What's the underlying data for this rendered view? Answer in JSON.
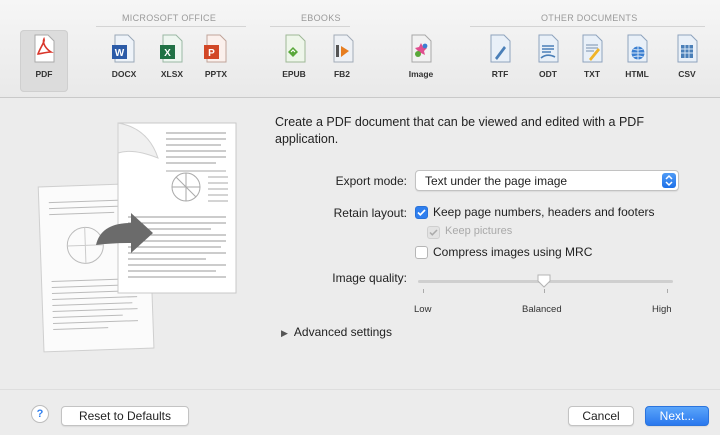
{
  "toolbar": {
    "groups": {
      "office": "MICROSOFT OFFICE",
      "ebooks": "EBOOKS",
      "other": "OTHER DOCUMENTS"
    },
    "formats": {
      "pdf": "PDF",
      "docx": "DOCX",
      "xlsx": "XLSX",
      "pptx": "PPTX",
      "epub": "EPUB",
      "fb2": "FB2",
      "image": "Image",
      "rtf": "RTF",
      "odt": "ODT",
      "txt": "TXT",
      "html": "HTML",
      "csv": "CSV"
    },
    "selected": "PDF",
    "colors": {
      "pdf": "#d9362b",
      "word": "#2b5ba8",
      "excel": "#207245",
      "ppt": "#d24726",
      "epub": "#59a83a",
      "fb2": "#e67e22",
      "doc": "#4a7fb8"
    }
  },
  "main": {
    "description": "Create a PDF document that can be viewed and edited with a PDF application.",
    "export_mode": {
      "label": "Export mode:",
      "value": "Text under the page image"
    },
    "retain_layout": {
      "label": "Retain layout:"
    },
    "options": {
      "page_numbers": {
        "label": "Keep page numbers, headers and footers",
        "checked": true
      },
      "pictures": {
        "label": "Keep pictures",
        "checked": true,
        "disabled": true
      },
      "mrc": {
        "label": "Compress images using MRC",
        "checked": false
      }
    },
    "image_quality": {
      "label": "Image quality:",
      "ticks": {
        "low": "Low",
        "balanced": "Balanced",
        "high": "High"
      },
      "value": "Balanced"
    },
    "advanced": "Advanced settings"
  },
  "footer": {
    "help": "?",
    "reset": "Reset to Defaults",
    "cancel": "Cancel",
    "next": "Next..."
  },
  "accent": "#2f7fef"
}
